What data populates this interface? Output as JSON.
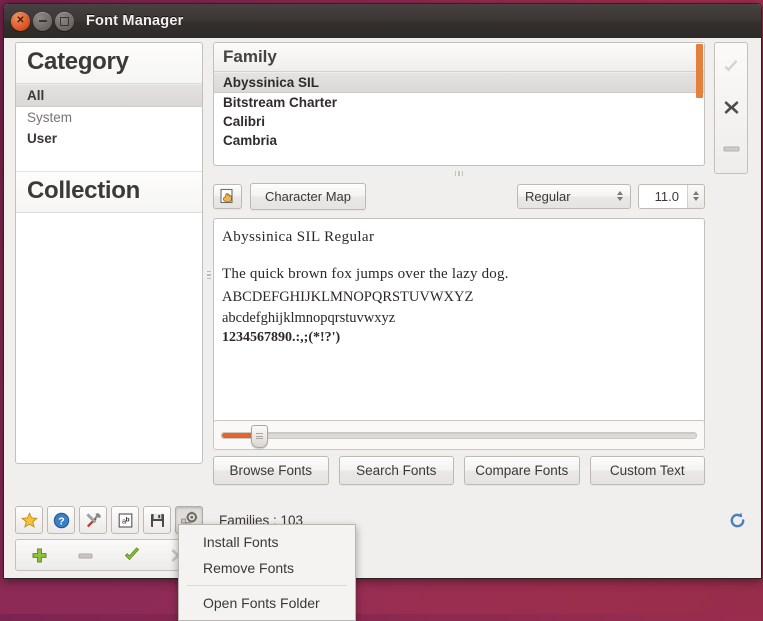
{
  "window": {
    "title": "Font Manager",
    "controls": {
      "close": "×",
      "minimize": "−",
      "maximize": "□"
    }
  },
  "sidebar": {
    "category": {
      "heading": "Category",
      "items": [
        {
          "label": "All",
          "state": "selected"
        },
        {
          "label": "System",
          "state": "dim"
        },
        {
          "label": "User",
          "state": "bold"
        }
      ]
    },
    "collection": {
      "heading": "Collection",
      "items": []
    },
    "buttons": [
      {
        "name": "add-collection-button",
        "icon": "plus-icon",
        "label": "+"
      },
      {
        "name": "remove-collection-button",
        "icon": "minus-icon",
        "label": "−"
      },
      {
        "name": "enable-collection-button",
        "icon": "check-icon",
        "label": "✓"
      },
      {
        "name": "disable-collection-button",
        "icon": "cross-icon",
        "label": "✕"
      }
    ]
  },
  "family": {
    "header": "Family",
    "items": [
      {
        "label": "Abyssinica SIL",
        "state": "selected"
      },
      {
        "label": "Bitstream Charter",
        "state": "normal"
      },
      {
        "label": "Calibri",
        "state": "normal"
      },
      {
        "label": "Cambria",
        "state": "normal"
      }
    ],
    "scrollbar_color": "#e4803f"
  },
  "toolbar": {
    "charmap_icon": "character-map-icon",
    "charmap_label": "Character Map",
    "style": {
      "value": "Regular",
      "options": [
        "Regular"
      ]
    },
    "size": {
      "value": "11.0"
    }
  },
  "preview": {
    "title": "Abyssinica SIL Regular",
    "pangram": "The quick brown fox jumps over the lazy dog.",
    "uppercase": "ABCDEFGHIJKLMNOPQRSTUVWXYZ",
    "lowercase": "abcdefghijklmnopqrstuvwxyz",
    "digits": "1234567890.:,;(*!?')"
  },
  "slider": {
    "value_percent": 7,
    "accent": "#e4642b"
  },
  "main_buttons": [
    {
      "name": "browse-fonts-button",
      "label": "Browse Fonts"
    },
    {
      "name": "search-fonts-button",
      "label": "Search Fonts"
    },
    {
      "name": "compare-fonts-button",
      "label": "Compare Fonts"
    },
    {
      "name": "custom-text-button",
      "label": "Custom Text"
    }
  ],
  "right_toolbar": [
    {
      "name": "enable-font-button",
      "icon": "check-icon",
      "label": "✓",
      "state": "disabled"
    },
    {
      "name": "disable-font-button",
      "icon": "cross-icon",
      "label": "✕",
      "state": "enabled"
    },
    {
      "name": "clear-font-button",
      "icon": "minus-icon",
      "label": "−",
      "state": "disabled"
    }
  ],
  "statusbar": {
    "buttons": [
      {
        "name": "favorites-button",
        "icon": "star-icon"
      },
      {
        "name": "help-button",
        "icon": "help-icon"
      },
      {
        "name": "preferences-button",
        "icon": "tools-icon"
      },
      {
        "name": "text-button",
        "icon": "ab-text-icon"
      },
      {
        "name": "save-button",
        "icon": "floppy-disk-icon"
      },
      {
        "name": "manage-fonts-button",
        "icon": "gear-fonts-icon",
        "state": "pressed"
      }
    ],
    "families_label": "Families : 103",
    "refresh_icon": "refresh-icon"
  },
  "context_menu": {
    "items": [
      {
        "label": "Install Fonts",
        "type": "item"
      },
      {
        "label": "Remove Fonts",
        "type": "item"
      },
      {
        "type": "separator"
      },
      {
        "label": "Open Fonts Folder",
        "type": "item"
      }
    ]
  }
}
